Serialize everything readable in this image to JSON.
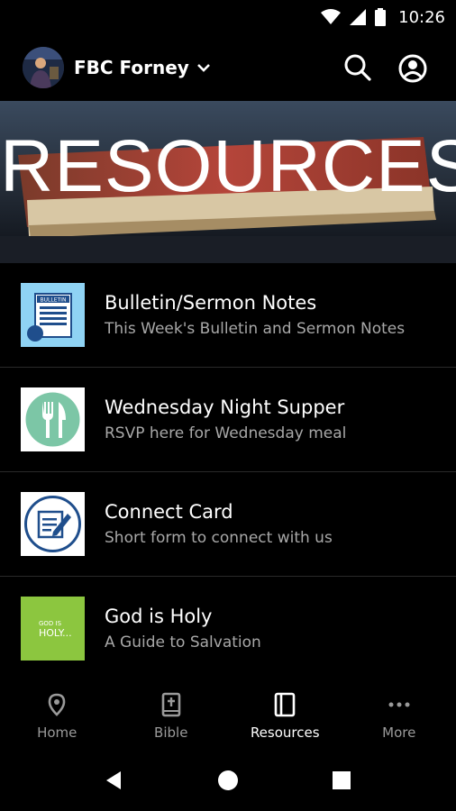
{
  "status_bar": {
    "time": "10:26"
  },
  "header": {
    "org_name": "FBC Forney",
    "icons": [
      "church-avatar",
      "chevron-down-icon",
      "search-icon",
      "account-icon"
    ]
  },
  "banner": {
    "title": "RESOURCES"
  },
  "resources": [
    {
      "title": "Bulletin/Sermon Notes",
      "subtitle": "This Week's Bulletin and Sermon Notes",
      "thumb_text": "BULLETIN",
      "thumb_bg": "#8fd3f4"
    },
    {
      "title": "Wednesday Night Supper",
      "subtitle": "RSVP here for Wednesday meal",
      "thumb_bg": "#ffffff",
      "thumb_accent": "#7cc6a6"
    },
    {
      "title": "Connect Card",
      "subtitle": "Short form to connect with us",
      "thumb_bg": "#ffffff",
      "thumb_accent": "#1f4e8c"
    },
    {
      "title": "God is Holy",
      "subtitle": "A Guide to Salvation",
      "thumb_text_line1": "GOD IS",
      "thumb_text_line2": "HOLY...",
      "thumb_bg": "#8cc63f"
    }
  ],
  "bottom_nav": [
    {
      "label": "Home",
      "icon": "location-pin-icon",
      "active": false
    },
    {
      "label": "Bible",
      "icon": "bible-icon",
      "active": false
    },
    {
      "label": "Resources",
      "icon": "book-icon",
      "active": true
    },
    {
      "label": "More",
      "icon": "more-dots-icon",
      "active": false
    }
  ],
  "system_nav": {
    "icons": [
      "back-icon",
      "home-circle-icon",
      "recents-icon"
    ]
  },
  "colors": {
    "background": "#000000",
    "subtitle": "#a8a8a8",
    "nav_inactive": "#9a9a9a"
  }
}
